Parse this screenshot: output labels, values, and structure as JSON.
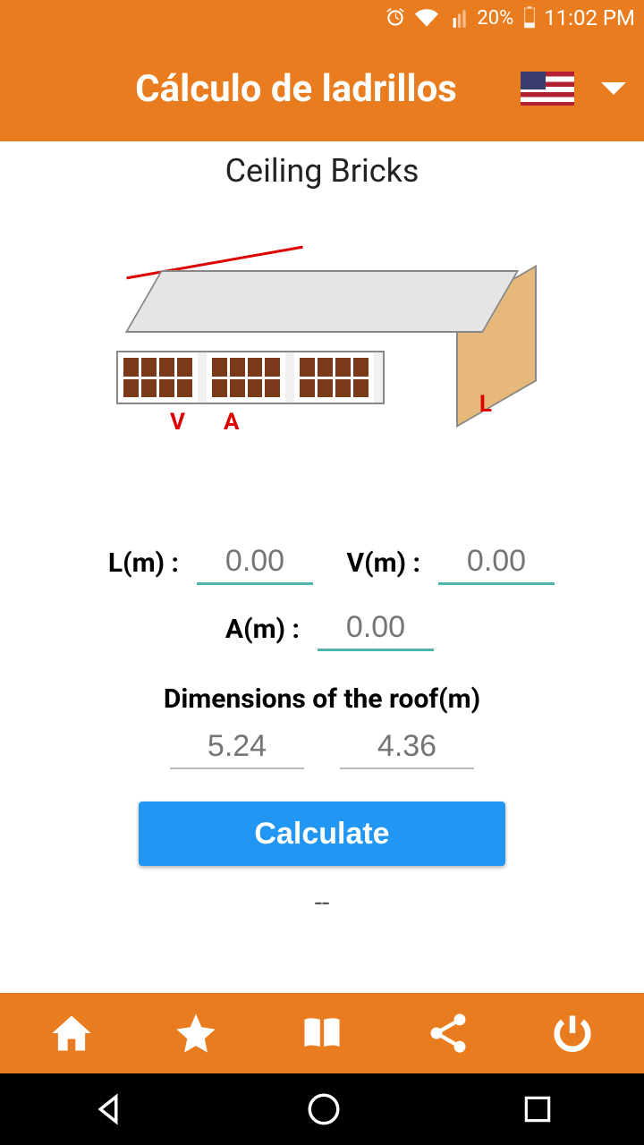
{
  "status": {
    "battery": "20%",
    "time": "11:02 PM"
  },
  "header": {
    "title": "Cálculo de ladrillos"
  },
  "content": {
    "section_title": "Ceiling Bricks",
    "labels": {
      "L": "L(m) :",
      "V": "V(m) :",
      "A": "A(m) :"
    },
    "placeholders": {
      "L": "0.00",
      "V": "0.00",
      "A": "0.00"
    },
    "diagram_labels": {
      "V": "V",
      "A": "A",
      "L": "L"
    },
    "dimensions_heading": "Dimensions of the roof(m)",
    "dim1": "5.24",
    "dim2": "4.36",
    "calculate_label": "Calculate",
    "result": "--"
  }
}
